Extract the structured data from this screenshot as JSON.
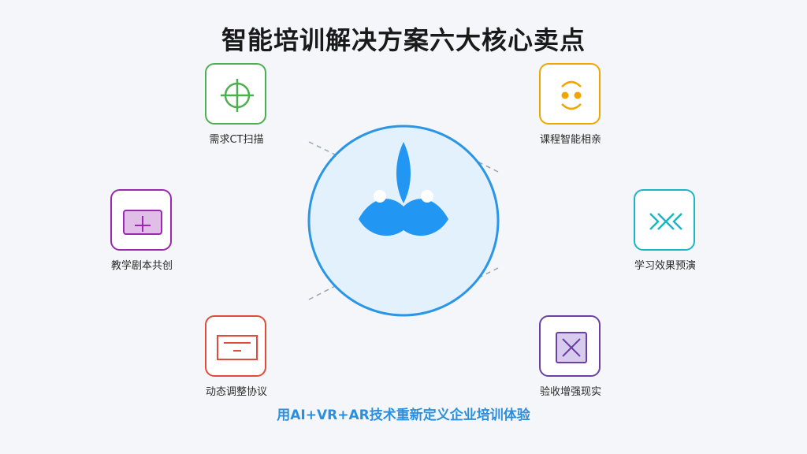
{
  "title": "智能培训解决方案六大核心卖点",
  "subtitle": "用AI+VR+AR技术重新定义企业培训体验",
  "nodes": [
    {
      "label": "需求CT扫描",
      "icon": "crosshair-icon",
      "color": "#4caf50"
    },
    {
      "label": "课程智能相亲",
      "icon": "smile-face-icon",
      "color": "#f0a500"
    },
    {
      "label": "教学剧本共创",
      "icon": "plus-card-icon",
      "color": "#9c27b0"
    },
    {
      "label": "学习效果预演",
      "icon": "wave-cross-icon",
      "color": "#1ab6c4"
    },
    {
      "label": "动态调整协议",
      "icon": "document-minus-icon",
      "color": "#e04b3c"
    },
    {
      "label": "验收增强现实",
      "icon": "x-box-icon",
      "color": "#6a3fa8"
    }
  ],
  "center": {
    "icon": "flame-cloud-icon",
    "color": "#2196f3",
    "bg": "#e3f1fc"
  }
}
